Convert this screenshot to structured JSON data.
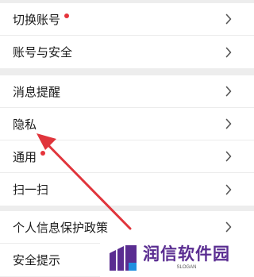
{
  "groups": [
    {
      "items": [
        {
          "label": "切换账号",
          "badge": true
        },
        {
          "label": "账号与安全",
          "badge": false
        }
      ]
    },
    {
      "items": [
        {
          "label": "消息提醒",
          "badge": false
        },
        {
          "label": "隐私",
          "badge": false
        },
        {
          "label": "通用",
          "badge": true
        },
        {
          "label": "扫一扫",
          "badge": false
        }
      ]
    },
    {
      "items": [
        {
          "label": "个人信息保护政策",
          "badge": false
        },
        {
          "label": "安全提示",
          "badge": false
        }
      ]
    }
  ],
  "chevron_icon": "chevron-right-icon",
  "colors": {
    "badge": "#e5343b",
    "chevron": "#555555",
    "annotation_arrow": "#e0353c",
    "brand_purple": "#5a2d91",
    "brand_blue": "#1f8fe0"
  },
  "watermark": {
    "name": "润信软件园",
    "slogan": "SLOGAN"
  }
}
